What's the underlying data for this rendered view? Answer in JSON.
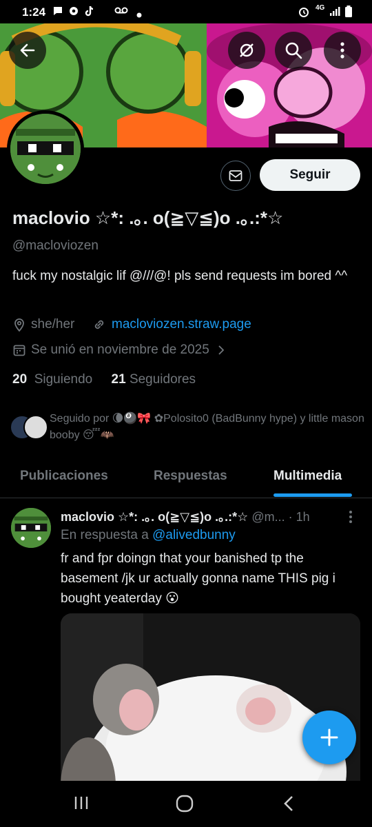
{
  "status_bar": {
    "time": "1:24",
    "signal_text": "4G"
  },
  "profile": {
    "name": "maclovio ☆*: .｡. o(≧▽≦)o .｡.:*☆",
    "handle": "@macloviozen",
    "bio": "fuck my nostalgic lif @///@!  pls send requests im bored ^^",
    "pronouns": "she/her",
    "website": "macloviozen.straw.page",
    "joined": "Se unió en noviembre de 2025",
    "following_count": "20",
    "following_label": "Siguiendo",
    "followers_count": "21",
    "followers_label": "Seguidores",
    "followed_by_prefix": "Seguido por",
    "followed_by_names": "🌘🎱🎀 ✿Polosito0 (BadBunny hype) y little mason booby 😴🦇",
    "follow_button": "Seguir"
  },
  "tabs": [
    {
      "label": "Publicaciones"
    },
    {
      "label": "Respuestas"
    },
    {
      "label": "Multimedia",
      "active": true
    }
  ],
  "post": {
    "author": "maclovio ☆*: .｡. o(≧▽≦)o .｡.:*☆",
    "handle_short": "@m...",
    "time": "· 1h",
    "reply_prefix": "En respuesta a",
    "reply_to": "@alivedbunny",
    "text": "fr and fpr doingn that your banished tp the basement /jk ur actually gonna name THIS pig i bought yeaterday 😮"
  },
  "colors": {
    "accent": "#1d9bf0",
    "background": "#000000",
    "muted": "#71767b",
    "text": "#e7e9ea"
  }
}
